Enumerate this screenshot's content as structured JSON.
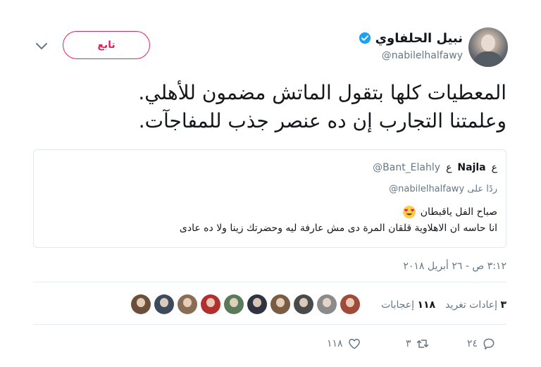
{
  "tweet": {
    "author_name": "نبيل الحلفاوي",
    "author_handle": "@nabilelhalfawy",
    "follow_label": "تابع",
    "text_lines": [
      "المعطيات كلها بتقول الماتش مضمون للأهلي.",
      "وعلمتنا التجارب إن ده عنصر جذب للمفاجآت."
    ],
    "timestamp": "٣:١٢ ص - ٢٦ أبريل ٢٠١٨"
  },
  "quote": {
    "name": "Najla",
    "name_decoration": "ع",
    "handle": "@Bant_Elahly",
    "reply_to_prefix": "ردًا على",
    "reply_to_handle": "@nabilelhalfawy",
    "line1": "صباح الفل ياقبطان",
    "line1_emoji": "heart-eyes-emoji",
    "line2": "انا حاسه ان الاهلاوية قلقان المرة دى مش عارفة ليه وحضرتك زينا ولا ده عادى"
  },
  "stats": {
    "retweets_count": "٣",
    "retweets_label": "إعادات تغريد",
    "likes_count": "١١٨",
    "likes_label": "إعجابات"
  },
  "likers": [
    {
      "color": "#6b4f3a"
    },
    {
      "color": "#3d4a5c"
    },
    {
      "color": "#8a6d55"
    },
    {
      "color": "#b03030"
    },
    {
      "color": "#5a7a5a"
    },
    {
      "color": "#2e3440"
    },
    {
      "color": "#7a5c44"
    },
    {
      "color": "#4a4a4a"
    },
    {
      "color": "#8b8b8b"
    },
    {
      "color": "#a04a3a"
    }
  ],
  "actions": {
    "reply_count": "٢٤",
    "retweet_count": "٣",
    "like_count": "١١٨"
  },
  "colors": {
    "follow": "#e0245e",
    "verified": "#1da1f2",
    "muted": "#657786"
  }
}
